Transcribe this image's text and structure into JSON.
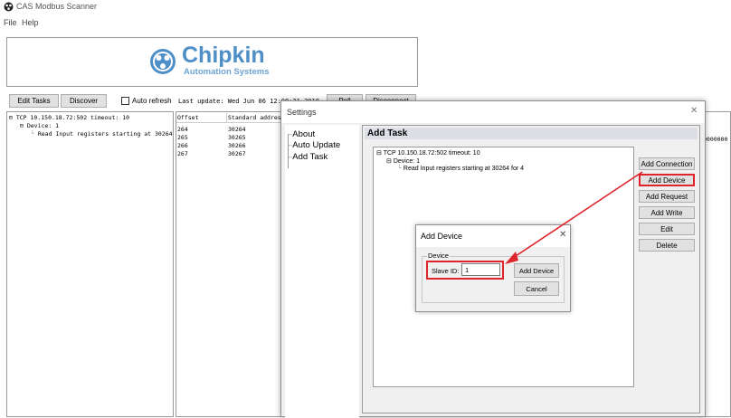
{
  "app": {
    "title": "CAS Modbus Scanner",
    "menu": [
      "File",
      "Help"
    ]
  },
  "logo": {
    "brand": "Chipkin",
    "tagline": "Automation Systems"
  },
  "toolbar": {
    "edit_tasks": "Edit Tasks",
    "discover": "Discover",
    "auto_refresh": "Auto refresh",
    "last_update": "Last update: Wed Jun 06 12:00:31 2018",
    "poll": "Poll",
    "disconnect": "Disconnect"
  },
  "left_tree": {
    "connection": "TCP 10.150.18.72:502 timeout: 10",
    "device": "Device: 1",
    "request": "Read Input registers starting at 30264 for 4"
  },
  "register_table": {
    "headers": [
      "Offset",
      "Standard address"
    ],
    "rows": [
      [
        "264",
        "30264"
      ],
      [
        "265",
        "30265"
      ],
      [
        "266",
        "30266"
      ],
      [
        "267",
        "30267"
      ]
    ],
    "right_edge_value": "0000000"
  },
  "settings": {
    "title": "Settings",
    "close": "✕",
    "nav": [
      "About",
      "Auto Update",
      "Add Task"
    ],
    "section_title": "Add Task",
    "tree": {
      "connection": "TCP 10.150.18.72:502 timeout: 10",
      "device": "Device: 1",
      "request": "Read Input registers starting at 30264 for 4"
    },
    "buttons": [
      "Add Connection",
      "Add Device",
      "Add Request",
      "Add Write",
      "Edit",
      "Delete"
    ]
  },
  "add_device": {
    "title": "Add Device",
    "close": "✕",
    "group_label": "Device",
    "slave_label": "Slave ID:",
    "slave_value": "1",
    "add_button": "Add Device",
    "cancel_button": "Cancel"
  },
  "colors": {
    "highlight": "#e0242b",
    "section_header_bg": "#dcdfe6"
  }
}
